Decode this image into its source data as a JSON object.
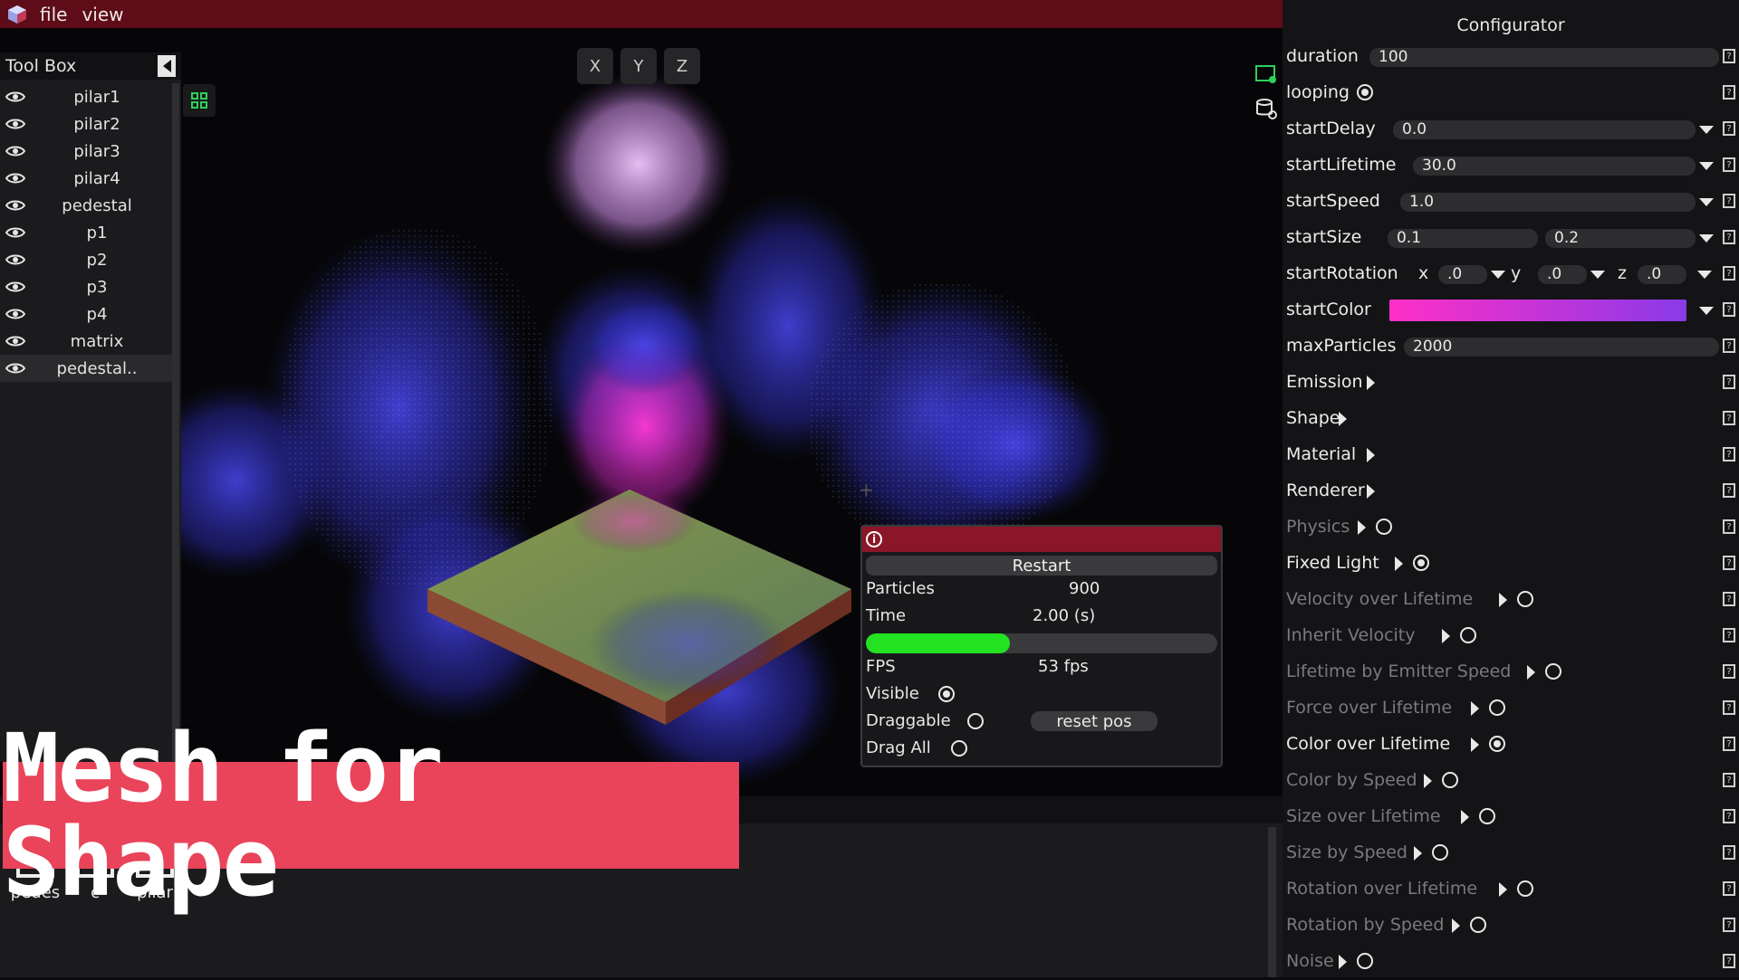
{
  "menu": {
    "file": "file",
    "view": "view"
  },
  "viewport": {
    "axis_buttons": [
      "X",
      "Y",
      "Z"
    ]
  },
  "toolbox": {
    "title": "Tool Box",
    "items": [
      "pilar1",
      "pilar2",
      "pilar3",
      "pilar4",
      "pedestal",
      "p1",
      "p2",
      "p3",
      "p4",
      "matrix",
      "pedestal.."
    ]
  },
  "overlay": {
    "title": "Mesh for Shape"
  },
  "assets": {
    "items": [
      "pedes",
      "c",
      "pilar"
    ]
  },
  "info_window": {
    "restart": "Restart",
    "particles_label": "Particles",
    "particles_value": "900",
    "time_label": "Time",
    "time_value": "2.00 (s)",
    "progress": 0.41,
    "fps_label": "FPS",
    "fps_value": "53 fps",
    "visible_label": "Visible",
    "visible_on": true,
    "draggable_label": "Draggable",
    "draggable_on": false,
    "reset_pos": "reset pos",
    "drag_all_label": "Drag All",
    "drag_all_on": false
  },
  "configurator": {
    "title": "Configurator",
    "duration_label": "duration",
    "duration_value": "100",
    "looping_label": "looping",
    "start_delay_label": "startDelay",
    "start_delay_value": "0.0",
    "start_lifetime_label": "startLifetime",
    "start_lifetime_value": "30.0",
    "start_speed_label": "startSpeed",
    "start_speed_value": "1.0",
    "start_size_label": "startSize",
    "start_size_min": "0.1",
    "start_size_max": "0.2",
    "start_rotation_label": "startRotation",
    "rot_x_label": "x",
    "rot_x_value": ".0",
    "rot_y_label": "y",
    "rot_y_value": ".0",
    "rot_z_label": "z",
    "rot_z_value": ".0",
    "start_color_label": "startColor",
    "start_color_gradient": [
      "#ff2fc6",
      "#8a3ae8"
    ],
    "max_particles_label": "maxParticles",
    "max_particles_value": "2000",
    "modules": [
      {
        "label": "Emission",
        "enabled": true,
        "has_toggle": false,
        "on": false
      },
      {
        "label": "Shape",
        "enabled": true,
        "has_toggle": false,
        "on": false
      },
      {
        "label": "Material",
        "enabled": true,
        "has_toggle": false,
        "on": false
      },
      {
        "label": "Renderer",
        "enabled": true,
        "has_toggle": false,
        "on": false
      },
      {
        "label": "Physics",
        "enabled": false,
        "has_toggle": true,
        "on": false
      },
      {
        "label": "Fixed Light",
        "enabled": true,
        "has_toggle": true,
        "on": true
      },
      {
        "label": "Velocity over Lifetime",
        "enabled": false,
        "has_toggle": true,
        "on": false
      },
      {
        "label": "Inherit Velocity",
        "enabled": false,
        "has_toggle": true,
        "on": false
      },
      {
        "label": "Lifetime by Emitter Speed",
        "enabled": false,
        "has_toggle": true,
        "on": false
      },
      {
        "label": "Force over Lifetime",
        "enabled": false,
        "has_toggle": true,
        "on": false
      },
      {
        "label": "Color over Lifetime",
        "enabled": true,
        "has_toggle": true,
        "on": true
      },
      {
        "label": "Color by Speed",
        "enabled": false,
        "has_toggle": true,
        "on": false
      },
      {
        "label": "Size over Lifetime",
        "enabled": false,
        "has_toggle": true,
        "on": false
      },
      {
        "label": "Size by Speed",
        "enabled": false,
        "has_toggle": true,
        "on": false
      },
      {
        "label": "Rotation over Lifetime",
        "enabled": false,
        "has_toggle": true,
        "on": false
      },
      {
        "label": "Rotation by Speed",
        "enabled": false,
        "has_toggle": true,
        "on": false
      },
      {
        "label": "Noise",
        "enabled": false,
        "has_toggle": true,
        "on": false
      }
    ]
  },
  "colors": {
    "menubar": "#5e0c18",
    "window_titlebar": "#8a1628",
    "progress_fill": "#22e222",
    "banner": "#e9445a",
    "particle_blue": "#3a3ae8",
    "particle_pink": "#e030c8",
    "particle_lilac": "#d9a2ec"
  }
}
